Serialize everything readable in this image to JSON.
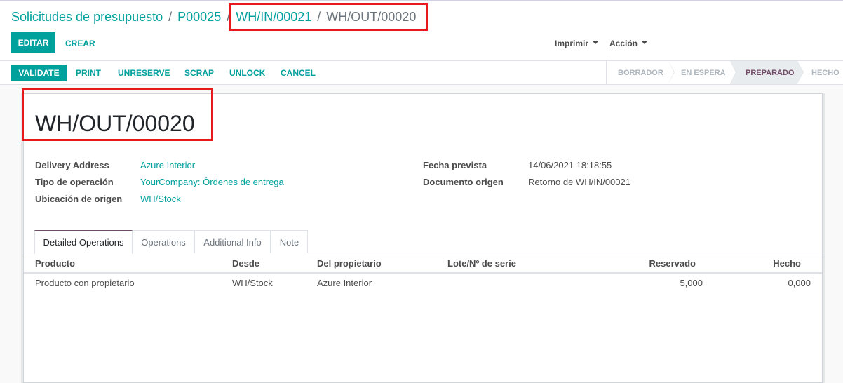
{
  "breadcrumb": {
    "items": [
      "Solicitudes de presupuesto",
      "P00025",
      "WH/IN/00021"
    ],
    "separator": "/",
    "active": "WH/OUT/00020"
  },
  "control_panel": {
    "edit_label": "EDITAR",
    "create_label": "CREAR",
    "print_dropdown": "Imprimir",
    "action_dropdown": "Acción"
  },
  "statusbar": {
    "buttons": [
      "VALIDATE",
      "PRINT",
      "UNRESERVE",
      "SCRAP",
      "UNLOCK",
      "CANCEL"
    ],
    "stages": [
      "BORRADOR",
      "EN ESPERA",
      "PREPARADO",
      "HECHO"
    ],
    "active_stage": "PREPARADO"
  },
  "record": {
    "title": "WH/OUT/00020",
    "left_fields": [
      {
        "label": "Delivery Address",
        "value": "Azure Interior"
      },
      {
        "label": "Tipo de operación",
        "value": "YourCompany: Órdenes de entrega"
      },
      {
        "label": "Ubicación de origen",
        "value": "WH/Stock"
      }
    ],
    "right_fields": [
      {
        "label": "Fecha prevista",
        "value": "14/06/2021 18:18:55"
      },
      {
        "label": "Documento origen",
        "value": "Retorno de WH/IN/00021"
      }
    ]
  },
  "tabs": [
    "Detailed Operations",
    "Operations",
    "Additional Info",
    "Note"
  ],
  "active_tab": "Detailed Operations",
  "table": {
    "columns": [
      "Producto",
      "Desde",
      "Del propietario",
      "Lote/Nº de serie",
      "Reservado",
      "Hecho"
    ],
    "rows": [
      [
        "Producto con propietario",
        "WH/Stock",
        "Azure Interior",
        "",
        "5,000",
        "0,000"
      ]
    ]
  },
  "colors": {
    "primary": "#00a09d",
    "brand": "#714b67",
    "highlight_box": "#e8191c"
  }
}
